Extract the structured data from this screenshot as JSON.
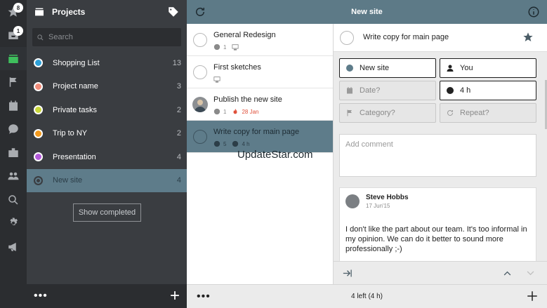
{
  "rail": {
    "badges": {
      "starred": "8",
      "inbox": "1"
    },
    "icons": [
      "star-icon",
      "inbox-icon",
      "projects-icon",
      "flag-icon",
      "calendar-icon",
      "chat-icon",
      "briefcase-icon",
      "people-icon",
      "search-icon",
      "gear-icon",
      "megaphone-icon"
    ],
    "active_color": "#3fbf5d"
  },
  "projects": {
    "title": "Projects",
    "search_placeholder": "Search",
    "items": [
      {
        "name": "Shopping List",
        "count": "13",
        "color": "#2da0d8"
      },
      {
        "name": "Project name",
        "count": "3",
        "color": "#f08c7a"
      },
      {
        "name": "Private tasks",
        "count": "2",
        "color": "#c8d63a"
      },
      {
        "name": "Trip to NY",
        "count": "2",
        "color": "#f39a1e"
      },
      {
        "name": "Presentation",
        "count": "4",
        "color": "#b35ad9"
      },
      {
        "name": "New site",
        "count": "4",
        "color": "#3a3d41"
      }
    ],
    "show_completed": "Show completed",
    "footer_more": "•••",
    "footer_add": "+"
  },
  "tasks": {
    "title": "New site",
    "items": [
      {
        "title": "General Redesign",
        "comments": "",
        "due": ""
      },
      {
        "title": "First sketches",
        "comments": "",
        "due": ""
      },
      {
        "title": "Publish the new site",
        "comments": "1",
        "due": "28 Jan"
      },
      {
        "title": "Write copy for main page",
        "comments": "5",
        "due": "4 h"
      }
    ],
    "first_comment_count": "1",
    "footer_more": "•••",
    "footer_status": "4 left (4 h)"
  },
  "watermark": "UpdateStar.com",
  "detail": {
    "title": "Write copy for main page",
    "project": "New site",
    "assignee": "You",
    "date_placeholder": "Date?",
    "duration": "4 h",
    "category_placeholder": "Category?",
    "repeat_placeholder": "Repeat?",
    "comment_placeholder": "Add comment",
    "comment": {
      "author": "Steve Hobbs",
      "date": "17 Jun'15",
      "text": "I don't like the part about our team. It's too informal in my opinion. We can do it better to sound more professionally ;-)"
    }
  }
}
